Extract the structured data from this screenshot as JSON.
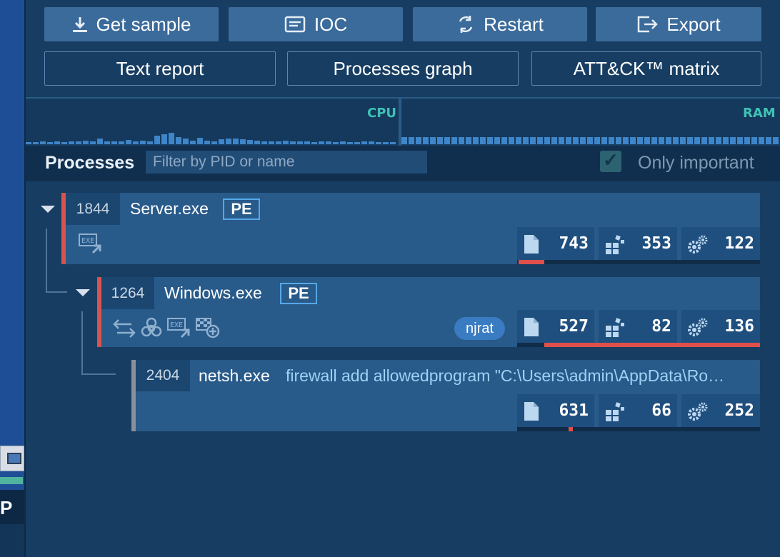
{
  "toolbar": {
    "get_sample": "Get sample",
    "ioc": "IOC",
    "restart": "Restart",
    "export": "Export",
    "text_report": "Text report",
    "processes_graph": "Processes graph",
    "attack_matrix": "ATT&CK™ matrix"
  },
  "monitor": {
    "cpu_label": "CPU",
    "ram_label": "RAM"
  },
  "processes": {
    "title": "Processes",
    "filter_placeholder": "Filter by PID or name",
    "only_important_label": "Only important",
    "only_important_checked": true,
    "items": [
      {
        "pid": "1844",
        "name": "Server.exe",
        "type_badge": "PE",
        "files": "743",
        "registry": "353",
        "modules": "122",
        "accent": "#d9534f"
      },
      {
        "pid": "1264",
        "name": "Windows.exe",
        "type_badge": "PE",
        "tag": "njrat",
        "files": "527",
        "registry": "82",
        "modules": "136",
        "accent": "#d9534f"
      },
      {
        "pid": "2404",
        "name": "netsh.exe",
        "cmdline": "firewall add allowedprogram \"C:\\Users\\admin\\AppData\\Ro…",
        "files": "631",
        "registry": "66",
        "modules": "252",
        "accent": "#8a9098"
      }
    ]
  },
  "colors": {
    "background": "#173d62",
    "accent_malicious": "#d9534f",
    "monitor_label": "#3fc2b5",
    "badge_border": "#55a9e9"
  }
}
